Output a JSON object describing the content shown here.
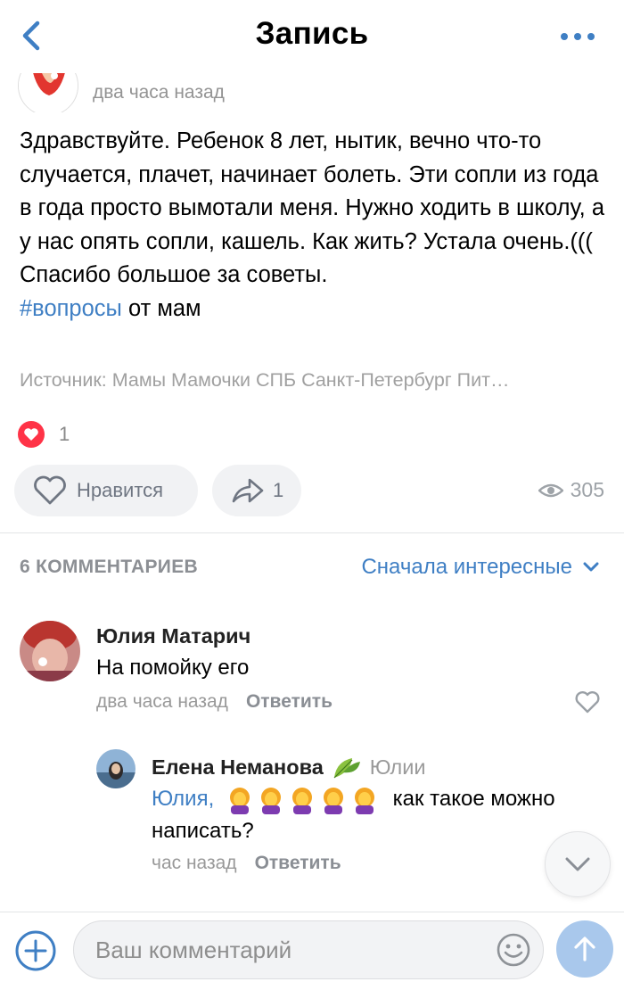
{
  "header": {
    "title": "Запись"
  },
  "post": {
    "time": "два часа назад",
    "text": "Здравствуйте. Ребенок 8 лет, нытик, вечно что-то случается, плачет, начинает болеть. Эти сопли из года в года просто вымотали меня. Нужно ходить в школу, а у нас опять сопли, кашель. Как жить? Устала очень.((( Спасибо большое за советы.",
    "hashtag": "#вопросы",
    "hashtag_suffix": " от мам",
    "source": "Источник: Мамы Мамочки СПБ Санкт-Петербург Пит…",
    "like_count": "1",
    "like_label": "Нравится",
    "share_count": "1",
    "views": "305"
  },
  "comments_section": {
    "count_label": "6 КОММЕНТАРИЕВ",
    "sort_label": "Сначала интересные"
  },
  "comments": [
    {
      "author": "Юлия Матарич",
      "text": "На помойку его",
      "time": "два часа назад",
      "reply_label": "Ответить"
    },
    {
      "author": "Елена Неманова",
      "to_whom": "Юлии",
      "mention": "Юлия,",
      "text_after": "как такое можно",
      "text_line2": "написать?",
      "time": "час назад",
      "reply_label": "Ответить",
      "emoji_icon": "facepalm-woman-emoji"
    }
  ],
  "composer": {
    "placeholder": "Ваш комментарий"
  },
  "colors": {
    "accent": "#3f7fc4",
    "like_red": "#ff3347",
    "send_button": "#a9c8ec"
  }
}
